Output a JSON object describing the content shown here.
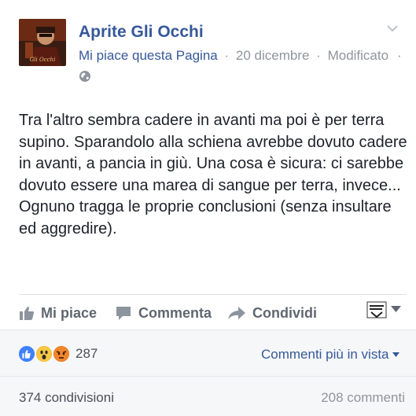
{
  "post": {
    "page_name": "Aprite Gli Occhi",
    "like_page": "Mi piace questa Pagina",
    "date": "20 dicembre",
    "edited": "Modificato",
    "meta_separator": "·",
    "privacy_icon": "globe-icon",
    "text_lines": [
      "Tra l'altro sembra cadere in avanti ma poi è per terra supino. Sparandolo alla schiena avrebbe dovuto cadere in avanti, a pancia in giù. Una cosa è sicura: ci sarebbe dovuto essere una marea di sangue per terra, invece...",
      "Ognuno tragga le proprie conclusioni (senza insultare ed aggredire)."
    ]
  },
  "actions": {
    "like": "Mi piace",
    "comment": "Commenta",
    "share": "Condividi"
  },
  "reactions": {
    "types": [
      "like",
      "wow",
      "angry"
    ],
    "count": "287",
    "sort_label": "Commenti più in vista"
  },
  "stats": {
    "shares": "374 condivisioni",
    "comments": "208 commenti"
  },
  "colors": {
    "link": "#365899",
    "muted": "#90949c",
    "action": "#606770",
    "like_blue": "#4080ff",
    "wow_yellow": "#f7b125",
    "angry_red": "#e9710f"
  }
}
